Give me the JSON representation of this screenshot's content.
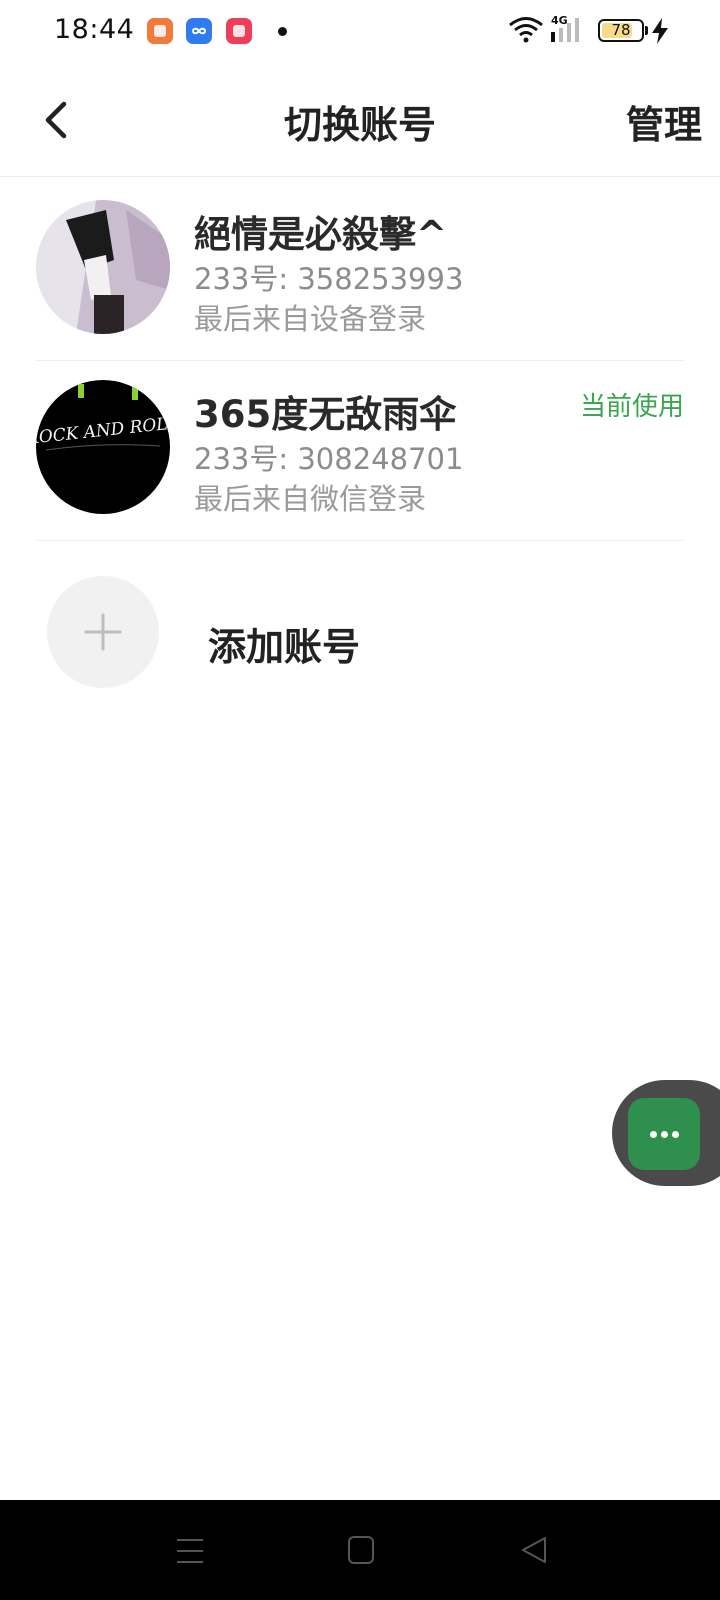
{
  "status_bar": {
    "time": "18:44",
    "network": "4G",
    "battery": "78",
    "battery_fraction": 0.78,
    "icons": [
      "books-app-icon",
      "infinity-app-icon",
      "video-app-icon",
      "notification-dot",
      "wifi-icon",
      "signal-icon",
      "battery-icon",
      "charging-icon"
    ]
  },
  "header": {
    "title": "切换账号",
    "manage_label": "管理",
    "back_icon": "chevron-left-icon"
  },
  "accounts": [
    {
      "name": "絕情是必殺擊^",
      "id_line": "233号: 358253993",
      "last_login": "最后来自设备登录",
      "current": false
    },
    {
      "name": "365度无敌雨伞",
      "id_line": "233号: 308248701",
      "last_login": "最后来自微信登录",
      "current": true,
      "current_label": "当前使用",
      "avatar_text": "ROCK AND ROLL"
    }
  ],
  "add_account": {
    "label": "添加账号",
    "icon": "plus-icon"
  },
  "floating": {
    "icon": "more-dots-icon",
    "color": "#2f8f4d"
  },
  "nav_bar": {
    "icons": [
      "menu-icon",
      "home-square-icon",
      "back-triangle-icon"
    ]
  },
  "colors": {
    "accent_green": "#3aa64e",
    "text_primary": "#222222",
    "text_secondary": "#8c8c8c"
  }
}
